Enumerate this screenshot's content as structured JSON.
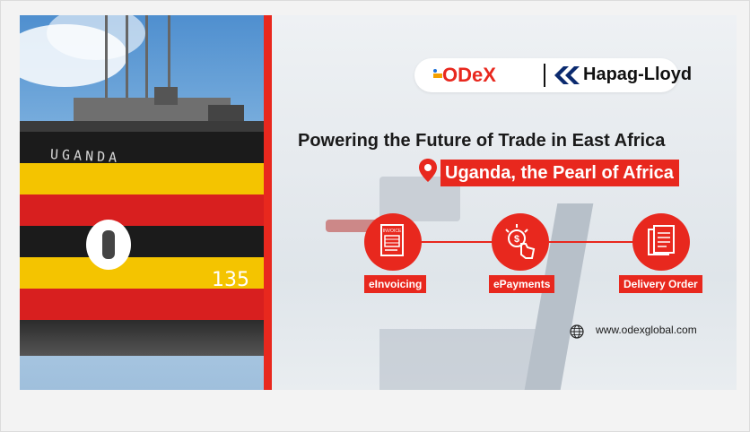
{
  "brand": {
    "odex": "ODeX",
    "partner": "Hapag-Lloyd"
  },
  "headline": "Powering the Future of Trade in East Africa",
  "subheadline": "Uganda, the Pearl of Africa",
  "features": [
    {
      "label": "eInvoicing",
      "icon_text": "INVOICE",
      "icon": "invoice-icon"
    },
    {
      "label": "ePayments",
      "icon_text": "$",
      "icon": "payment-tap-icon"
    },
    {
      "label": "Delivery Order",
      "icon": "document-stack-icon"
    }
  ],
  "container_text": {
    "country": "UGANDA",
    "number": "135"
  },
  "website": "www.odexglobal.com",
  "colors": {
    "accent": "#e8281e",
    "hapag_blue": "#0b2a6f",
    "text_dark": "#1a1a1a"
  }
}
